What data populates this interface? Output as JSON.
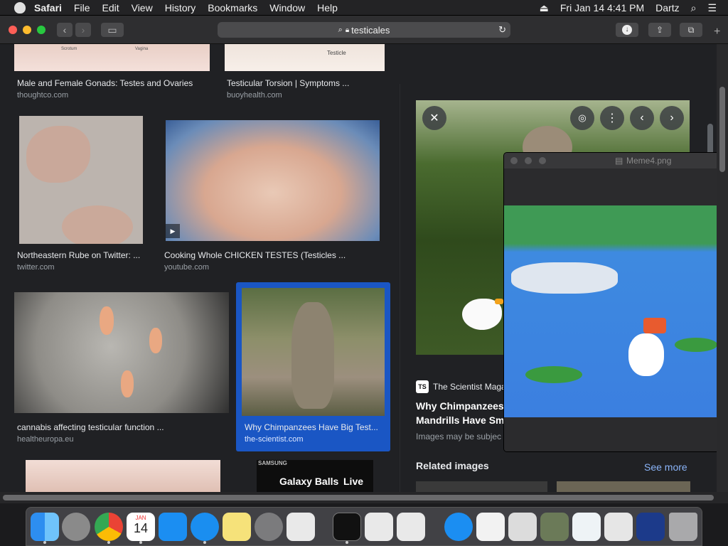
{
  "menubar": {
    "app_name": "Safari",
    "items": [
      "File",
      "Edit",
      "View",
      "History",
      "Bookmarks",
      "Window",
      "Help"
    ],
    "clock": "Fri Jan 14  4:41 PM",
    "user": "Dartz"
  },
  "toolbar": {
    "address": "testicales"
  },
  "results": [
    {
      "caption": "Male and Female Gonads: Testes and Ovaries",
      "source": "thoughtco.com"
    },
    {
      "caption": "Testicular Torsion | Symptoms ...",
      "source": "buoyhealth.com"
    },
    {
      "caption": "Northeastern Rube on Twitter: ...",
      "source": "twitter.com"
    },
    {
      "caption": "Cooking Whole CHICKEN TESTES (Testicles ...",
      "source": "youtube.com"
    },
    {
      "caption": "cannabis affecting testicular function ...",
      "source": "healtheuropa.eu"
    },
    {
      "caption": "Why Chimpanzees Have Big Test...",
      "source": "the-scientist.com"
    }
  ],
  "thumb_labels": {
    "diagram_left": "Scrotum",
    "diagram_left2": "Vagina",
    "diagram_right": "Testicle",
    "galaxy_brand": "SAMSUNG",
    "galaxy_text": "Galaxy Balls",
    "galaxy_live": "Live"
  },
  "panel": {
    "source_badge": "TS",
    "source_name": "The Scientist Maga",
    "title_line1": "Why Chimpanzees",
    "title_line2": "Mandrills Have Sm",
    "notice": "Images may be subjec",
    "related": "Related images",
    "see_more": "See more"
  },
  "preview_window": {
    "filename": "Meme4.png"
  },
  "dock": {
    "calendar_month": "JAN",
    "calendar_day": "14"
  },
  "colors": {
    "accent_blue": "#1a56c4",
    "link_blue": "#8ab4f8"
  }
}
